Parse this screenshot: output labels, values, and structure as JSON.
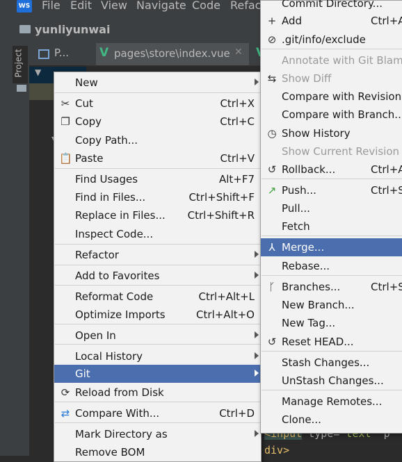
{
  "menubar": {
    "logo": "WS",
    "items": [
      "File",
      "Edit",
      "View",
      "Navigate",
      "Code",
      "Refact"
    ]
  },
  "navbar": {
    "project": "yunliyunwai"
  },
  "side": {
    "project_tab": "Project"
  },
  "tabs": {
    "collapsed": "P...",
    "file": "pages\\store\\index.vue"
  },
  "code": {
    "line1_tag": "<input",
    "line1_attr": " type=",
    "line1_str": "\"text\"",
    "line1_rest": " p",
    "line2": "div>"
  },
  "context_menu": [
    {
      "label": "New",
      "shortcut": "",
      "submenu": true
    },
    {
      "label": "Cut",
      "shortcut": "Ctrl+X",
      "icon": "cut-icon"
    },
    {
      "label": "Copy",
      "shortcut": "Ctrl+C",
      "icon": "copy-icon"
    },
    {
      "label": "Copy Path...",
      "shortcut": ""
    },
    {
      "label": "Paste",
      "shortcut": "Ctrl+V",
      "icon": "paste-icon"
    },
    {
      "label": "Find Usages",
      "shortcut": "Alt+F7"
    },
    {
      "label": "Find in Files...",
      "shortcut": "Ctrl+Shift+F"
    },
    {
      "label": "Replace in Files...",
      "shortcut": "Ctrl+Shift+R"
    },
    {
      "label": "Inspect Code...",
      "shortcut": ""
    },
    {
      "label": "Refactor",
      "shortcut": "",
      "submenu": true
    },
    {
      "label": "Add to Favorites",
      "shortcut": "",
      "submenu": true
    },
    {
      "label": "Reformat Code",
      "shortcut": "Ctrl+Alt+L"
    },
    {
      "label": "Optimize Imports",
      "shortcut": "Ctrl+Alt+O"
    },
    {
      "label": "Open In",
      "shortcut": "",
      "submenu": true
    },
    {
      "label": "Local History",
      "shortcut": "",
      "submenu": true
    },
    {
      "label": "Git",
      "shortcut": "",
      "submenu": true,
      "selected": true
    },
    {
      "label": "Reload from Disk",
      "shortcut": "",
      "icon": "reload-icon"
    },
    {
      "label": "Compare With...",
      "shortcut": "Ctrl+D",
      "icon": "compare-icon"
    },
    {
      "label": "Mark Directory as",
      "shortcut": "",
      "submenu": true
    },
    {
      "label": "Remove BOM",
      "shortcut": ""
    }
  ],
  "git_menu": [
    {
      "label": "Commit Directory...",
      "shortcut": ""
    },
    {
      "label": "Add",
      "shortcut": "Ctrl+A",
      "icon": "plus-icon"
    },
    {
      "label": ".git/info/exclude",
      "shortcut": "",
      "icon": "exclude-file-icon"
    },
    {
      "label": "Annotate with Git Blame",
      "shortcut": "",
      "disabled": true
    },
    {
      "label": "Show Diff",
      "shortcut": "",
      "disabled": true,
      "icon": "diff-icon"
    },
    {
      "label": "Compare with Revision...",
      "shortcut": ""
    },
    {
      "label": "Compare with Branch...",
      "shortcut": ""
    },
    {
      "label": "Show History",
      "shortcut": "",
      "icon": "history-icon"
    },
    {
      "label": "Show Current Revision",
      "shortcut": "",
      "disabled": true
    },
    {
      "label": "Rollback...",
      "shortcut": "Ctrl+A",
      "icon": "rollback-icon"
    },
    {
      "label": "Push...",
      "shortcut": "Ctrl+Shi",
      "icon": "push-icon"
    },
    {
      "label": "Pull...",
      "shortcut": ""
    },
    {
      "label": "Fetch",
      "shortcut": ""
    },
    {
      "label": "Merge...",
      "shortcut": "",
      "icon": "merge-icon",
      "selected": true
    },
    {
      "label": "Rebase...",
      "shortcut": ""
    },
    {
      "label": "Branches...",
      "shortcut": "Ctrl+Sh",
      "icon": "branch-icon"
    },
    {
      "label": "New Branch...",
      "shortcut": ""
    },
    {
      "label": "New Tag...",
      "shortcut": ""
    },
    {
      "label": "Reset HEAD...",
      "shortcut": "",
      "icon": "reset-icon"
    },
    {
      "label": "Stash Changes...",
      "shortcut": ""
    },
    {
      "label": "UnStash Changes...",
      "shortcut": ""
    },
    {
      "label": "Manage Remotes...",
      "shortcut": ""
    },
    {
      "label": "Clone...",
      "shortcut": ""
    }
  ],
  "colors": {
    "selection": "#4b6eaf",
    "menu_bg": "#f2f2f2",
    "ide_bg": "#2b2b2b",
    "vue_green": "#41b883"
  }
}
